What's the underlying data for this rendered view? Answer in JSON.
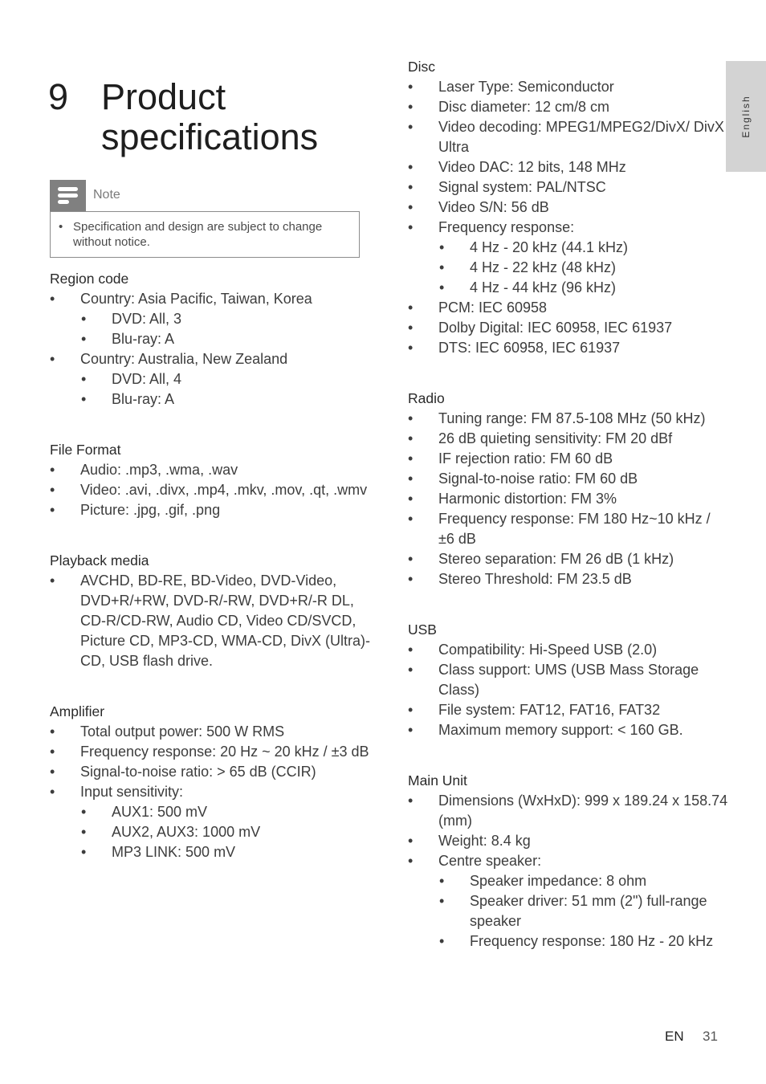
{
  "heading": {
    "number": "9",
    "title": "Product specifications"
  },
  "side_tab": {
    "label": "English"
  },
  "note": {
    "label": "Note",
    "icon": "note-icon",
    "items": [
      "Specification and design are subject to change without notice."
    ]
  },
  "left_sections": [
    {
      "title": "Region code",
      "items": [
        {
          "text": "Country: Asia Pacific, Taiwan, Korea",
          "level": 1
        },
        {
          "text": "DVD: All, 3",
          "level": 2
        },
        {
          "text": "Blu-ray: A",
          "level": 2
        },
        {
          "text": "Country: Australia, New Zealand",
          "level": 1
        },
        {
          "text": "DVD: All, 4",
          "level": 2
        },
        {
          "text": "Blu-ray: A",
          "level": 2
        }
      ]
    },
    {
      "title": "File Format",
      "items": [
        {
          "text": "Audio: .mp3, .wma, .wav",
          "level": 1
        },
        {
          "text": "Video: .avi, .divx, .mp4, .mkv, .mov, .qt, .wmv",
          "level": 1
        },
        {
          "text": "Picture: .jpg, .gif, .png",
          "level": 1
        }
      ]
    },
    {
      "title": "Playback media",
      "items": [
        {
          "text": "AVCHD, BD-RE, BD-Video, DVD-Video, DVD+R/+RW, DVD-R/-RW, DVD+R/-R DL, CD-R/CD-RW, Audio CD, Video CD/SVCD, Picture CD, MP3-CD, WMA-CD, DivX (Ultra)-CD, USB flash drive.",
          "level": 1
        }
      ]
    },
    {
      "title": "Amplifier",
      "items": [
        {
          "text": "Total output power: 500 W RMS",
          "level": 1
        },
        {
          "text": "Frequency response: 20 Hz ~ 20 kHz / ±3 dB",
          "level": 1
        },
        {
          "text": "Signal-to-noise ratio: > 65 dB (CCIR)",
          "level": 1
        },
        {
          "text": "Input sensitivity:",
          "level": 1
        },
        {
          "text": "AUX1: 500 mV",
          "level": 2
        },
        {
          "text": "AUX2, AUX3: 1000 mV",
          "level": 2
        },
        {
          "text": "MP3 LINK: 500 mV",
          "level": 2
        }
      ]
    }
  ],
  "right_sections": [
    {
      "title": "Disc",
      "items": [
        {
          "text": "Laser Type: Semiconductor",
          "level": 1
        },
        {
          "text": "Disc diameter: 12 cm/8 cm",
          "level": 1
        },
        {
          "text": "Video decoding: MPEG1/MPEG2/DivX/ DivX Ultra",
          "level": 1
        },
        {
          "text": "Video DAC: 12 bits, 148 MHz",
          "level": 1
        },
        {
          "text": "Signal system: PAL/NTSC",
          "level": 1
        },
        {
          "text": "Video S/N: 56 dB",
          "level": 1
        },
        {
          "text": "Frequency response:",
          "level": 1
        },
        {
          "text": "4 Hz - 20 kHz (44.1 kHz)",
          "level": 2
        },
        {
          "text": "4 Hz - 22 kHz (48 kHz)",
          "level": 2
        },
        {
          "text": "4 Hz - 44 kHz (96 kHz)",
          "level": 2
        },
        {
          "text": "PCM: IEC 60958",
          "level": 1
        },
        {
          "text": "Dolby Digital: IEC 60958, IEC 61937",
          "level": 1
        },
        {
          "text": "DTS: IEC 60958, IEC 61937",
          "level": 1
        }
      ]
    },
    {
      "title": "Radio",
      "items": [
        {
          "text": "Tuning range: FM 87.5-108 MHz (50 kHz)",
          "level": 1
        },
        {
          "text": "26 dB quieting sensitivity: FM 20 dBf",
          "level": 1
        },
        {
          "text": "IF rejection ratio: FM 60 dB",
          "level": 1
        },
        {
          "text": "Signal-to-noise ratio: FM 60 dB",
          "level": 1
        },
        {
          "text": "Harmonic distortion: FM 3%",
          "level": 1
        },
        {
          "text": "Frequency response: FM 180 Hz~10 kHz / ±6 dB",
          "level": 1
        },
        {
          "text": "Stereo separation: FM 26 dB (1 kHz)",
          "level": 1
        },
        {
          "text": "Stereo Threshold: FM 23.5 dB",
          "level": 1
        }
      ]
    },
    {
      "title": "USB",
      "items": [
        {
          "text": "Compatibility: Hi-Speed USB (2.0)",
          "level": 1
        },
        {
          "text": "Class support: UMS (USB Mass Storage Class)",
          "level": 1
        },
        {
          "text": "File system: FAT12, FAT16, FAT32",
          "level": 1
        },
        {
          "text": "Maximum memory support: < 160 GB.",
          "level": 1
        }
      ]
    },
    {
      "title": "Main Unit",
      "items": [
        {
          "text": "Dimensions (WxHxD): 999 x 189.24 x 158.74 (mm)",
          "level": 1
        },
        {
          "text": "Weight: 8.4 kg",
          "level": 1
        },
        {
          "text": "Centre speaker:",
          "level": 1
        },
        {
          "text": "Speaker impedance: 8 ohm",
          "level": 2
        },
        {
          "text": "Speaker driver: 51 mm (2\") full-range speaker",
          "level": 2
        },
        {
          "text": "Frequency response: 180 Hz - 20 kHz",
          "level": 2
        }
      ]
    }
  ],
  "footer": {
    "language": "EN",
    "page_number": "31"
  }
}
